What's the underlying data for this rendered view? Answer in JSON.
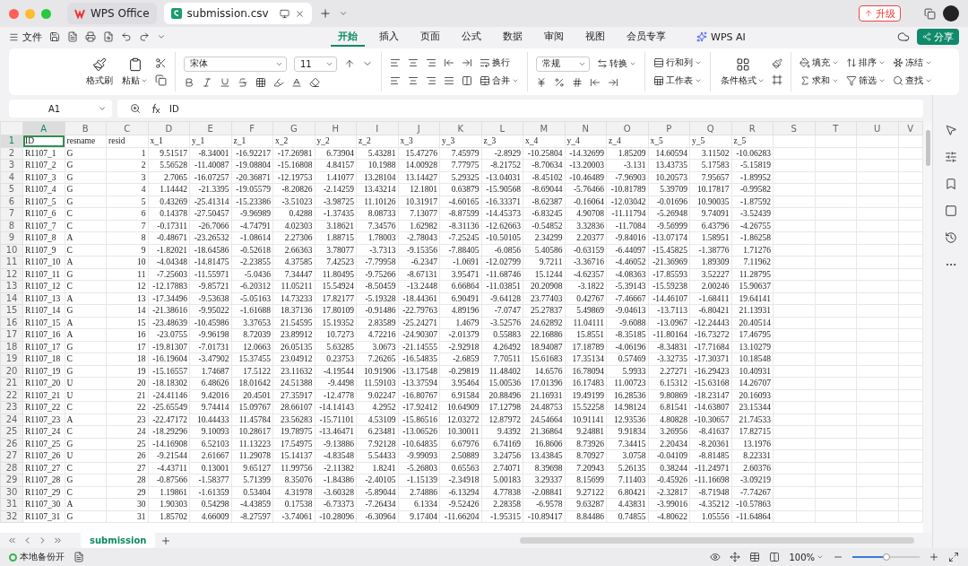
{
  "window": {
    "tabs": [
      {
        "label": "WPS Office",
        "kind": "home",
        "selected": false
      },
      {
        "label": "submission.csv",
        "kind": "sheet",
        "selected": true
      }
    ],
    "upgrade": "升级"
  },
  "menu": {
    "file": "文件",
    "tabs": [
      {
        "label": "开始",
        "selected": true
      },
      {
        "label": "插入",
        "selected": false
      },
      {
        "label": "页面",
        "selected": false
      },
      {
        "label": "公式",
        "selected": false
      },
      {
        "label": "数据",
        "selected": false
      },
      {
        "label": "审阅",
        "selected": false
      },
      {
        "label": "视图",
        "selected": false
      },
      {
        "label": "会员专享",
        "selected": false
      }
    ],
    "ai": "WPS AI",
    "share": "分享"
  },
  "ribbon": {
    "format_painter": "格式刷",
    "paste": "粘贴",
    "font": "宋体",
    "size": "11",
    "wrap": "换行",
    "merge": "合并",
    "number_format": "常规",
    "convert": "转换",
    "rows_cols": "行和列",
    "worksheet": "工作表",
    "conditional_format": "条件格式",
    "fill": "填充",
    "sort": "排序",
    "freeze": "冻结",
    "sum": "求和",
    "filter": "筛选",
    "find": "查找"
  },
  "formula_bar": {
    "cell": "A1",
    "value": "ID"
  },
  "sheet": {
    "columns": [
      {
        "label": "A",
        "selected": true
      },
      {
        "label": "B",
        "selected": false
      },
      {
        "label": "C",
        "selected": false
      },
      {
        "label": "D",
        "selected": false
      },
      {
        "label": "E",
        "selected": false
      },
      {
        "label": "F",
        "selected": false
      },
      {
        "label": "G",
        "selected": false
      },
      {
        "label": "H",
        "selected": false
      },
      {
        "label": "I",
        "selected": false
      },
      {
        "label": "J",
        "selected": false
      },
      {
        "label": "K",
        "selected": false
      },
      {
        "label": "L",
        "selected": false
      },
      {
        "label": "M",
        "selected": false
      },
      {
        "label": "N",
        "selected": false
      },
      {
        "label": "O",
        "selected": false
      },
      {
        "label": "P",
        "selected": false
      },
      {
        "label": "Q",
        "selected": false
      },
      {
        "label": "R",
        "selected": false
      },
      {
        "label": "S",
        "selected": false
      },
      {
        "label": "T",
        "selected": false
      },
      {
        "label": "U",
        "selected": false
      },
      {
        "label": "V",
        "selected": false
      }
    ],
    "rows": [
      {
        "number": "1",
        "selected": true,
        "cells": [
          "ID",
          "resname",
          "resid",
          "x_1",
          "y_1",
          "z_1",
          "x_2",
          "y_2",
          "z_2",
          "x_3",
          "y_3",
          "z_3",
          "x_4",
          "y_4",
          "z_4",
          "x_5",
          "y_5",
          "z_5"
        ]
      },
      {
        "number": "2",
        "selected": false,
        "cells": [
          "R1107_1",
          "G",
          "1",
          "9.51517",
          "-8.34001",
          "-16.92217",
          "-17.26981",
          "6.73904",
          "5.43281",
          "15.47276",
          "7.45979",
          "-2.8929",
          "-10.25804",
          "-14.32699",
          "1.85209",
          "14.60594",
          "3.11502",
          "-10.06283"
        ]
      },
      {
        "number": "3",
        "selected": false,
        "cells": [
          "R1107_2",
          "G",
          "2",
          "5.56528",
          "-11.40087",
          "-19.08804",
          "-15.16808",
          "4.84157",
          "10.1988",
          "14.00928",
          "7.77975",
          "-8.21752",
          "-8.70634",
          "-13.20003",
          "-3.131",
          "13.43735",
          "5.17583",
          "-5.15819"
        ]
      },
      {
        "number": "4",
        "selected": false,
        "cells": [
          "R1107_3",
          "G",
          "3",
          "2.7065",
          "-16.07257",
          "-20.36871",
          "-12.19753",
          "1.41077",
          "13.28104",
          "13.14427",
          "5.29325",
          "-13.04031",
          "-8.45102",
          "-10.46489",
          "-7.96903",
          "10.20573",
          "7.95657",
          "-1.89952"
        ]
      },
      {
        "number": "5",
        "selected": false,
        "cells": [
          "R1107_4",
          "G",
          "4",
          "1.14442",
          "-21.3395",
          "-19.05579",
          "-8.20826",
          "-2.14259",
          "13.43214",
          "12.1801",
          "0.63879",
          "-15.90568",
          "-8.69044",
          "-5.76466",
          "-10.81789",
          "5.39709",
          "10.17817",
          "-0.99582"
        ]
      },
      {
        "number": "6",
        "selected": false,
        "cells": [
          "R1107_5",
          "G",
          "5",
          "0.43269",
          "-25.41314",
          "-15.23386",
          "-3.51023",
          "-3.98725",
          "11.10126",
          "10.31917",
          "-4.60165",
          "-16.33371",
          "-8.62387",
          "-0.16064",
          "-12.03042",
          "-0.01696",
          "10.90035",
          "-1.87592"
        ]
      },
      {
        "number": "7",
        "selected": false,
        "cells": [
          "R1107_6",
          "C",
          "6",
          "0.14378",
          "-27.50457",
          "-9.96989",
          "0.4288",
          "-1.37435",
          "8.08733",
          "7.13077",
          "-8.87599",
          "-14.45373",
          "-6.83245",
          "4.90708",
          "-11.11794",
          "-5.26948",
          "9.74091",
          "-3.52439"
        ]
      },
      {
        "number": "8",
        "selected": false,
        "cells": [
          "R1107_7",
          "C",
          "7",
          "-0.17311",
          "-26.7066",
          "-4.74791",
          "4.02303",
          "3.18621",
          "7.34576",
          "1.62982",
          "-8.31136",
          "-12.62663",
          "-0.54852",
          "3.32836",
          "-11.7084",
          "-9.56999",
          "6.43796",
          "-4.26755"
        ]
      },
      {
        "number": "9",
        "selected": false,
        "cells": [
          "R1107_8",
          "A",
          "8",
          "-0.48671",
          "-23.26532",
          "-1.08614",
          "2.27306",
          "1.88715",
          "1.78003",
          "-2.78043",
          "-7.25245",
          "-10.50105",
          "2.34299",
          "2.20377",
          "-9.84016",
          "-13.07174",
          "1.58951",
          "-1.86258"
        ]
      },
      {
        "number": "10",
        "selected": false,
        "cells": [
          "R1107_9",
          "C",
          "9",
          "-1.82021",
          "-18.64586",
          "-0.52618",
          "2.66363",
          "3.78077",
          "-3.7313",
          "-9.15356",
          "-7.88405",
          "-6.0856",
          "5.40586",
          "-0.63159",
          "-6.44097",
          "-15.45825",
          "-1.38776",
          "1.71276"
        ]
      },
      {
        "number": "11",
        "selected": false,
        "cells": [
          "R1107_10",
          "A",
          "10",
          "-4.04348",
          "-14.81475",
          "-2.23855",
          "4.37585",
          "7.42523",
          "-7.79958",
          "-6.2347",
          "-1.0691",
          "-12.02799",
          "9.7211",
          "-3.36716",
          "-4.46052",
          "-21.36969",
          "1.89309",
          "7.11962"
        ]
      },
      {
        "number": "12",
        "selected": false,
        "cells": [
          "R1107_11",
          "G",
          "11",
          "-7.25603",
          "-11.55971",
          "-5.0436",
          "7.34447",
          "11.80495",
          "-9.75266",
          "-8.67131",
          "3.95471",
          "-11.68746",
          "15.1244",
          "-4.62357",
          "-4.08363",
          "-17.85593",
          "3.52227",
          "11.28795"
        ]
      },
      {
        "number": "13",
        "selected": false,
        "cells": [
          "R1107_12",
          "C",
          "12",
          "-12.17883",
          "-9.85721",
          "-6.20312",
          "11.05211",
          "15.54924",
          "-8.50459",
          "-13.2448",
          "6.66864",
          "-11.03851",
          "20.20908",
          "-3.1822",
          "-5.39143",
          "-15.59238",
          "2.00246",
          "15.90637"
        ]
      },
      {
        "number": "14",
        "selected": false,
        "cells": [
          "R1107_13",
          "A",
          "13",
          "-17.34496",
          "-9.53638",
          "-5.05163",
          "14.73233",
          "17.82177",
          "-5.19328",
          "-18.44361",
          "6.90491",
          "-9.64128",
          "23.77403",
          "0.42767",
          "-7.46667",
          "-14.46107",
          "-1.68411",
          "19.64141"
        ]
      },
      {
        "number": "15",
        "selected": false,
        "cells": [
          "R1107_14",
          "G",
          "14",
          "-21.38616",
          "-9.95022",
          "-1.61688",
          "18.37136",
          "17.80109",
          "-0.91486",
          "-22.79763",
          "4.89196",
          "-7.0747",
          "25.27837",
          "5.49869",
          "-9.04613",
          "-13.7113",
          "-6.80421",
          "21.13931"
        ]
      },
      {
        "number": "16",
        "selected": false,
        "cells": [
          "R1107_15",
          "A",
          "15",
          "-23.48639",
          "-10.45986",
          "3.37653",
          "21.54595",
          "15.19352",
          "2.83589",
          "-25.24271",
          "1.4679",
          "-3.52576",
          "24.62892",
          "11.04111",
          "-9.6088",
          "-13.0967",
          "-12.24443",
          "20.40514"
        ]
      },
      {
        "number": "17",
        "selected": false,
        "cells": [
          "R1107_16",
          "A",
          "16",
          "-23.0755",
          "-9.96198",
          "8.72039",
          "23.89912",
          "10.7273",
          "4.72216",
          "-24.90307",
          "-2.01379",
          "0.55883",
          "22.16886",
          "15.8551",
          "-8.35185",
          "-11.80164",
          "-16.73272",
          "17.46795"
        ]
      },
      {
        "number": "18",
        "selected": false,
        "cells": [
          "R1107_17",
          "G",
          "17",
          "-19.81307",
          "-7.01731",
          "12.0663",
          "26.05135",
          "5.63285",
          "3.0673",
          "-21.14555",
          "-2.92918",
          "4.26492",
          "18.94087",
          "17.18789",
          "-4.06196",
          "-8.34831",
          "-17.71684",
          "13.10279"
        ]
      },
      {
        "number": "19",
        "selected": false,
        "cells": [
          "R1107_18",
          "C",
          "18",
          "-16.19604",
          "-3.47902",
          "15.37455",
          "23.04912",
          "0.23753",
          "7.26265",
          "-16.54835",
          "-2.6859",
          "7.70511",
          "15.61683",
          "17.35134",
          "0.57469",
          "-3.32735",
          "-17.30371",
          "10.18548"
        ]
      },
      {
        "number": "20",
        "selected": false,
        "cells": [
          "R1107_19",
          "G",
          "19",
          "-15.16557",
          "1.74687",
          "17.5122",
          "23.11632",
          "-4.19544",
          "10.91906",
          "-13.17548",
          "-0.29819",
          "11.48402",
          "14.6576",
          "16.78094",
          "5.9933",
          "2.27271",
          "-16.29423",
          "10.40931"
        ]
      },
      {
        "number": "21",
        "selected": false,
        "cells": [
          "R1107_20",
          "U",
          "20",
          "-18.18302",
          "6.48626",
          "18.01642",
          "24.51388",
          "-9.4498",
          "11.59103",
          "-13.37594",
          "3.95464",
          "15.00536",
          "17.01396",
          "16.17483",
          "11.00723",
          "6.15312",
          "-15.63168",
          "14.26707"
        ]
      },
      {
        "number": "22",
        "selected": false,
        "cells": [
          "R1107_21",
          "U",
          "21",
          "-24.41146",
          "9.42016",
          "20.4501",
          "27.35917",
          "-12.4778",
          "9.02247",
          "-16.80767",
          "6.91584",
          "20.88496",
          "21.16931",
          "19.49199",
          "16.28536",
          "9.80869",
          "-18.23147",
          "20.16093"
        ]
      },
      {
        "number": "23",
        "selected": false,
        "cells": [
          "R1107_22",
          "C",
          "22",
          "-25.65549",
          "9.74414",
          "15.09767",
          "28.66107",
          "-14.14143",
          "4.2952",
          "-17.92412",
          "10.64909",
          "17.12798",
          "24.48753",
          "15.52258",
          "14.98124",
          "6.81541",
          "-14.63807",
          "23.15344"
        ]
      },
      {
        "number": "24",
        "selected": false,
        "cells": [
          "R1107_23",
          "A",
          "23",
          "-22.47172",
          "10.44433",
          "11.45784",
          "23.56283",
          "-15.71101",
          "4.53109",
          "-15.86516",
          "12.03272",
          "12.87972",
          "24.54664",
          "10.91141",
          "12.93536",
          "4.80828",
          "-10.30657",
          "21.74533"
        ]
      },
      {
        "number": "25",
        "selected": false,
        "cells": [
          "R1107_24",
          "C",
          "24",
          "-18.29296",
          "9.10093",
          "10.28617",
          "19.78975",
          "-13.46471",
          "6.23481",
          "-13.06526",
          "10.30011",
          "9.4392",
          "21.36864",
          "9.24881",
          "9.91834",
          "3.26956",
          "-8.41637",
          "17.82715"
        ]
      },
      {
        "number": "26",
        "selected": false,
        "cells": [
          "R1107_25",
          "G",
          "25",
          "-14.16908",
          "6.52103",
          "11.13223",
          "17.54975",
          "-9.13886",
          "7.92128",
          "-10.64835",
          "6.67976",
          "6.74169",
          "16.8606",
          "8.73926",
          "7.34415",
          "2.20434",
          "-8.20361",
          "13.1976"
        ]
      },
      {
        "number": "27",
        "selected": false,
        "cells": [
          "R1107_26",
          "U",
          "26",
          "-9.21544",
          "2.61667",
          "11.29078",
          "15.14137",
          "-4.83548",
          "5.54433",
          "-9.99093",
          "2.50889",
          "3.24756",
          "13.43845",
          "8.70927",
          "3.0758",
          "-0.04109",
          "-8.81485",
          "8.22331"
        ]
      },
      {
        "number": "28",
        "selected": false,
        "cells": [
          "R1107_27",
          "C",
          "27",
          "-4.43711",
          "0.13001",
          "9.65127",
          "11.99756",
          "-2.11382",
          "1.8241",
          "-5.26803",
          "0.65563",
          "2.74071",
          "8.39698",
          "7.20943",
          "5.26135",
          "0.38244",
          "-11.24971",
          "2.60376"
        ]
      },
      {
        "number": "29",
        "selected": false,
        "cells": [
          "R1107_28",
          "G",
          "28",
          "-0.87566",
          "-1.58377",
          "5.71399",
          "8.35076",
          "-1.84386",
          "-2.40105",
          "-1.15139",
          "-2.34918",
          "5.00183",
          "3.29337",
          "8.15699",
          "7.11403",
          "-0.45926",
          "-11.16698",
          "-3.09219"
        ]
      },
      {
        "number": "30",
        "selected": false,
        "cells": [
          "R1107_29",
          "C",
          "29",
          "1.19861",
          "-1.61359",
          "0.53404",
          "4.31978",
          "-3.60328",
          "-5.89044",
          "2.74886",
          "-6.13294",
          "4.77838",
          "-2.08841",
          "9.27122",
          "6.80421",
          "-2.32817",
          "-8.71948",
          "-7.74267"
        ]
      },
      {
        "number": "31",
        "selected": false,
        "cells": [
          "R1107_30",
          "A",
          "30",
          "1.90303",
          "0.54298",
          "-4.43859",
          "0.17538",
          "-6.73373",
          "-7.26434",
          "6.1334",
          "-9.52426",
          "2.28358",
          "-6.9578",
          "9.63287",
          "4.43831",
          "-3.99016",
          "-4.35212",
          "-10.57863"
        ]
      },
      {
        "number": "32",
        "selected": false,
        "cells": [
          "R1107_31",
          "G",
          "31",
          "1.85702",
          "4.66009",
          "-8.27597",
          "-3.74061",
          "-10.28096",
          "-6.30964",
          "9.17404",
          "-11.66204",
          "-1.95315",
          "-10.89417",
          "8.84486",
          "0.74855",
          "-4.80622",
          "1.05556",
          "-11.64864"
        ]
      }
    ]
  },
  "sheet_tabs": [
    {
      "label": "submission",
      "selected": true
    }
  ],
  "status_bar": {
    "backup": "本地备份开",
    "backup_on": true,
    "zoom": "100%",
    "zoom_slider": {
      "level": 0.5
    }
  }
}
